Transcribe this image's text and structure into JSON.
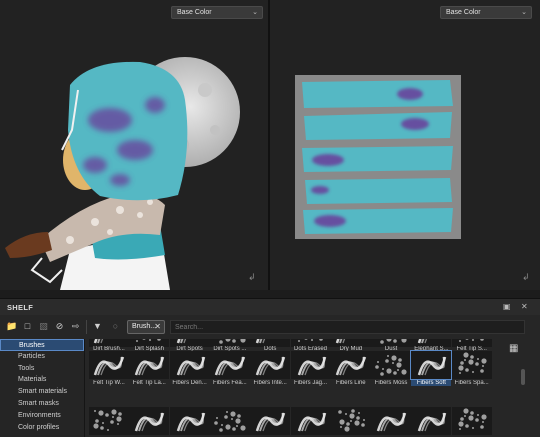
{
  "viewport3d": {
    "channel": "Base Color"
  },
  "viewport2d": {
    "channel": "Base Color"
  },
  "shelf": {
    "title": "SHELF",
    "toolbar": {
      "filter_chip": "Brush...",
      "search_placeholder": "Search..."
    },
    "categories": [
      {
        "label": "Brushes",
        "active": true
      },
      {
        "label": "Particles",
        "active": false
      },
      {
        "label": "Tools",
        "active": false
      },
      {
        "label": "Materials",
        "active": false
      },
      {
        "label": "Smart materials",
        "active": false
      },
      {
        "label": "Smart masks",
        "active": false
      },
      {
        "label": "Environments",
        "active": false
      },
      {
        "label": "Color profiles",
        "active": false
      }
    ],
    "brushes_row1": [
      "Dirt Brush...",
      "Dirt Splash",
      "Dirt Spots",
      "Dirt Spots ...",
      "Dots",
      "Dots Erased",
      "Dry Mud",
      "Dust",
      "Elephant S...",
      "Felt Tip S..."
    ],
    "brushes_row2": [
      "Felt Tip W...",
      "Felt Tip La...",
      "Fibers Den...",
      "Fibers Fea...",
      "Fibers Inte...",
      "Fibers Jag...",
      "Fibers Line",
      "Fibers Moss",
      "Fibers Soft",
      "Fibers Spa..."
    ],
    "selected_brush": "Fibers Soft"
  },
  "colors": {
    "accent": "#2b4b73",
    "teal": "#55b8c4",
    "purple": "#6a3d9a",
    "panel": "#222222"
  },
  "icons": [
    "folder-icon",
    "new-folder-icon",
    "delete-icon",
    "hide-icon",
    "import-icon",
    "filter-icon",
    "circle-icon",
    "close-icon",
    "grid-view-icon",
    "maximize-icon"
  ]
}
